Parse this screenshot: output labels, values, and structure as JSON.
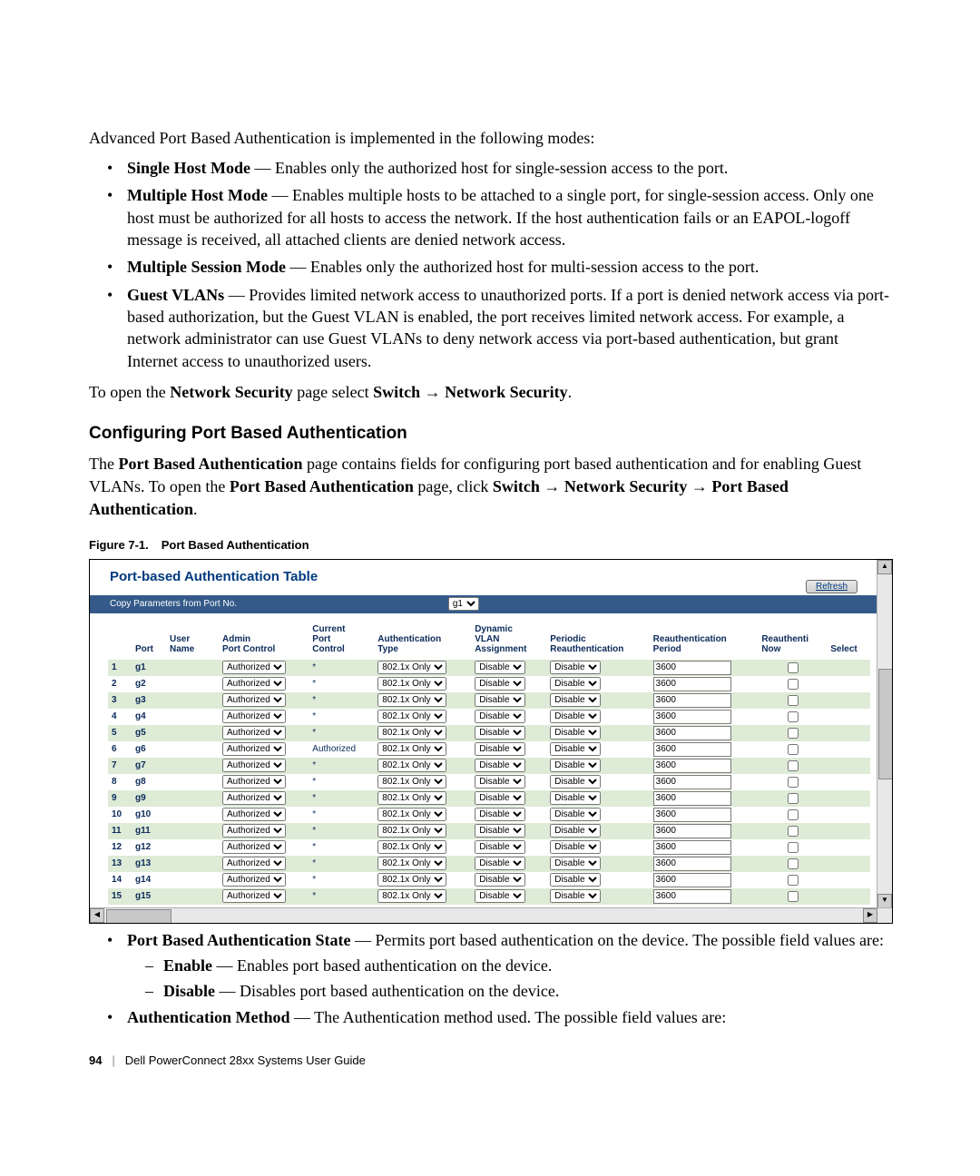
{
  "intro": "Advanced Port Based Authentication is implemented in the following modes:",
  "modes": [
    {
      "term": "Single Host Mode",
      "text": " — Enables only the authorized host for single-session access to the port."
    },
    {
      "term": "Multiple Host Mode",
      "text": " — Enables multiple hosts to be attached to a single port, for single-session access. Only one host must be authorized for all hosts to access the network. If the host authentication fails or an EAPOL-logoff message is received, all attached clients are denied network access."
    },
    {
      "term": "Multiple Session Mode",
      "text": " — Enables only the authorized host for multi-session access to the port."
    },
    {
      "term": "Guest VLANs",
      "text": " — Provides limited network access to unauthorized ports. If a port is denied network access via port-based authorization, but the Guest VLAN is enabled, the port receives limited network access. For example, a network administrator can use Guest VLANs to deny network access via port-based authentication, but grant Internet access to unauthorized users."
    }
  ],
  "open_line_prefix": "To open the ",
  "open_line_bold1": "Network Security",
  "open_line_mid": " page select ",
  "open_line_bold2": "Switch → Network Security",
  "open_line_suffix": ".",
  "section_heading": "Configuring Port Based Authentication",
  "config_para_prefix": "The ",
  "config_para_b1": "Port Based Authentication",
  "config_para_mid1": " page contains fields for configuring port based authentication and for enabling Guest VLANs. To open the ",
  "config_para_b2": "Port Based Authentication",
  "config_para_mid2": " page, click ",
  "config_para_b3": "Switch → Network Security → Port Based Authentication",
  "config_para_suffix": ".",
  "fig_label": "Figure 7-1.",
  "fig_title": "Port Based Authentication",
  "shot": {
    "title": "Port-based Authentication Table",
    "refresh": "Refresh",
    "copy_label": "Copy Parameters from Port No.",
    "copy_value": "g1",
    "headers": {
      "idx": "",
      "port": "Port",
      "user": "User Name",
      "admin": "Admin\nPort Control",
      "current": "Current\nPort\nControl",
      "auth": "Authentication\nType",
      "vlan": "Dynamic\nVLAN\nAssignment",
      "periodic": "Periodic\nReauthentication",
      "reauth": "Reauthentication\nPeriod",
      "now": "Reauthenti\nNow",
      "select": "Select"
    },
    "defaults": {
      "admin": "Authorized",
      "current_star": "*",
      "auth": "802.1x Only",
      "vlan": "Disable",
      "periodic": "Disable",
      "reauth": "3600"
    },
    "rows": [
      {
        "n": 1,
        "port": "g1",
        "current": "*"
      },
      {
        "n": 2,
        "port": "g2",
        "current": "*"
      },
      {
        "n": 3,
        "port": "g3",
        "current": "*"
      },
      {
        "n": 4,
        "port": "g4",
        "current": "*"
      },
      {
        "n": 5,
        "port": "g5",
        "current": "*"
      },
      {
        "n": 6,
        "port": "g6",
        "current": "Authorized"
      },
      {
        "n": 7,
        "port": "g7",
        "current": "*"
      },
      {
        "n": 8,
        "port": "g8",
        "current": "*"
      },
      {
        "n": 9,
        "port": "g9",
        "current": "*"
      },
      {
        "n": 10,
        "port": "g10",
        "current": "*"
      },
      {
        "n": 11,
        "port": "g11",
        "current": "*"
      },
      {
        "n": 12,
        "port": "g12",
        "current": "*"
      },
      {
        "n": 13,
        "port": "g13",
        "current": "*"
      },
      {
        "n": 14,
        "port": "g14",
        "current": "*"
      },
      {
        "n": 15,
        "port": "g15",
        "current": "*"
      }
    ]
  },
  "fields": [
    {
      "term": "Port Based Authentication State",
      "text": " — Permits port based authentication on the device. The possible field values are:",
      "sub": [
        {
          "term": "Enable",
          "text": " — Enables port based authentication on the device."
        },
        {
          "term": "Disable",
          "text": " — Disables port based authentication on the device."
        }
      ]
    },
    {
      "term": "Authentication Method",
      "text": " — The Authentication method used. The possible field values are:",
      "sub": []
    }
  ],
  "footer": {
    "page": "94",
    "sep": "|",
    "doc": "Dell PowerConnect 28xx Systems User Guide"
  }
}
